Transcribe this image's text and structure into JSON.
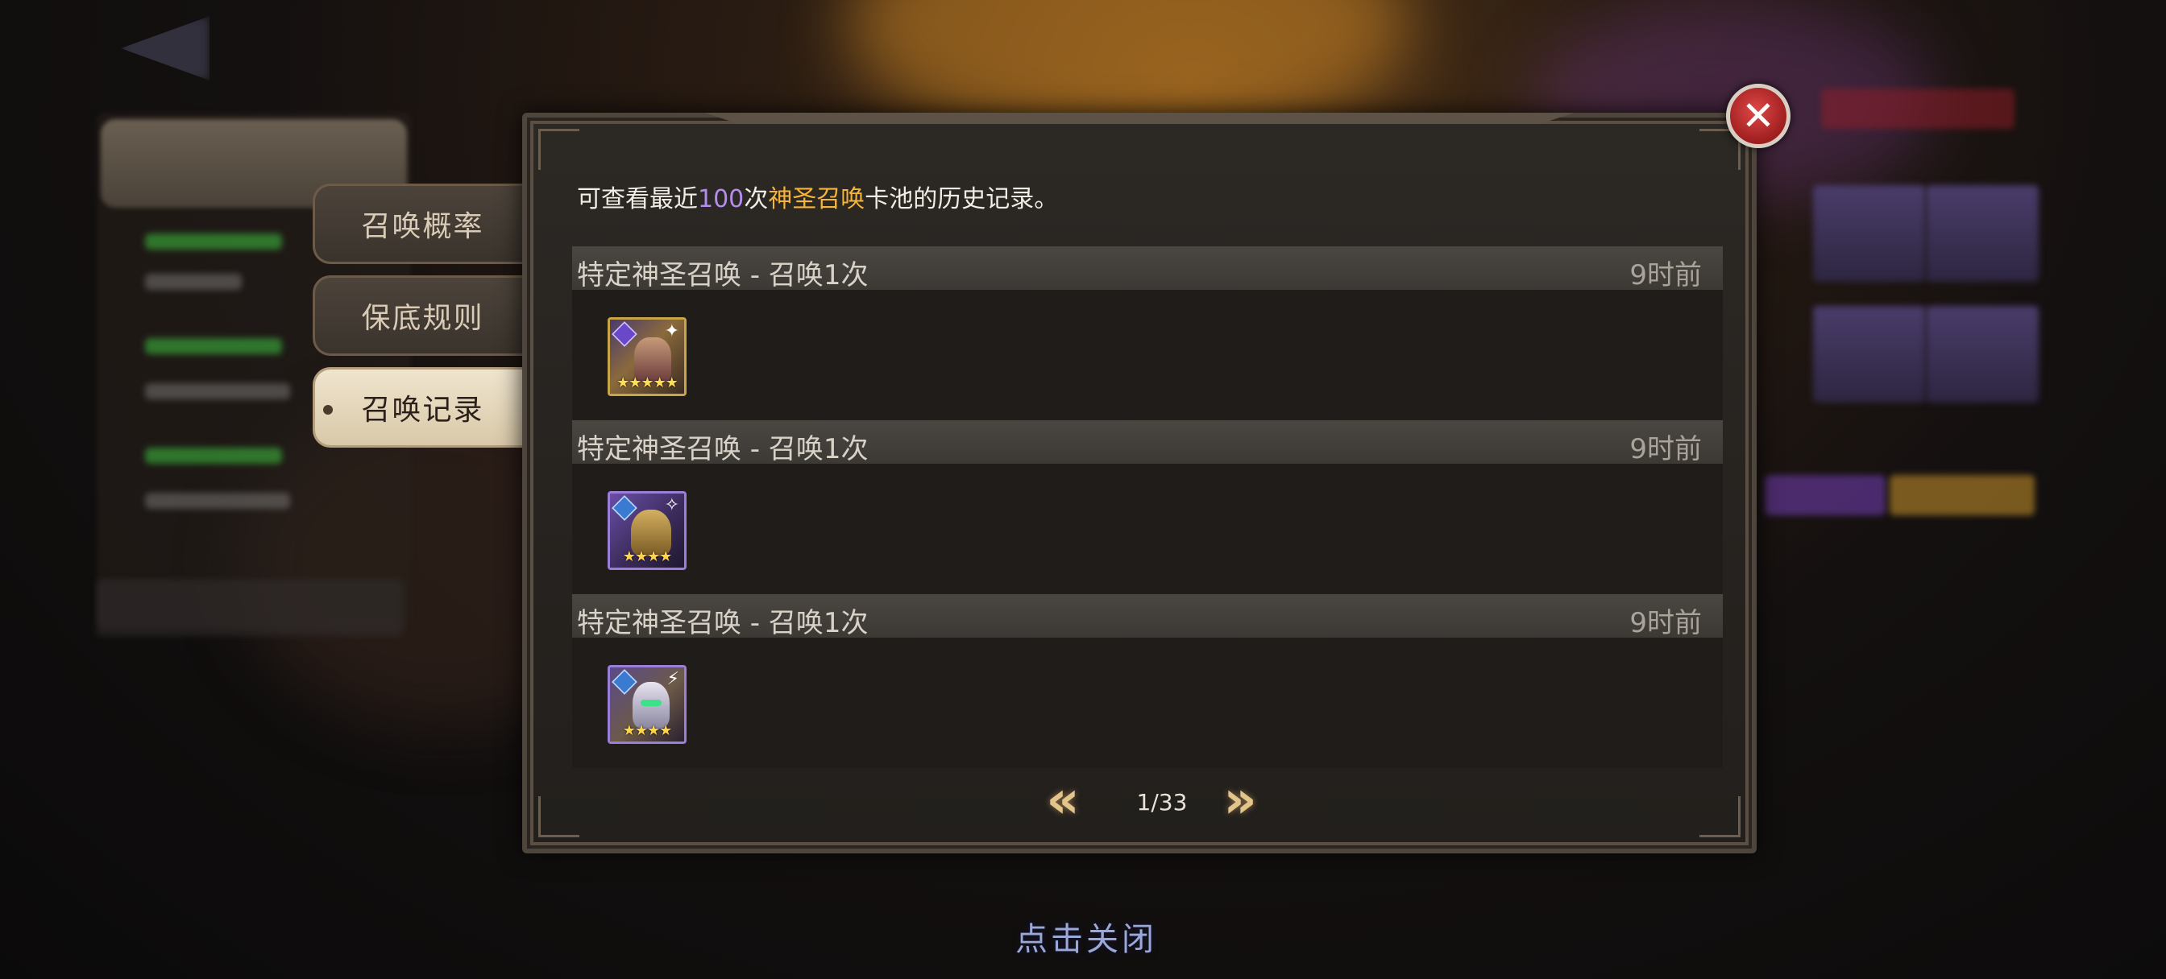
{
  "side_tabs": [
    {
      "label": "召唤概率",
      "active": false
    },
    {
      "label": "保底规则",
      "active": false
    },
    {
      "label": "召唤记录",
      "active": true
    }
  ],
  "dialog": {
    "intro": {
      "prefix": "可查看最近",
      "count": "100",
      "mid": "次",
      "pool_name": "神圣召唤",
      "suffix": "卡池的历史记录。"
    },
    "records": [
      {
        "title": "特定神圣召唤 - 召唤1次",
        "time": "9时前",
        "hero": {
          "stars": "★★★★★",
          "icon": "hero-portrait-icon"
        }
      },
      {
        "title": "特定神圣召唤 - 召唤1次",
        "time": "9时前",
        "hero": {
          "stars": "★★★★",
          "icon": "hero-portrait-icon"
        }
      },
      {
        "title": "特定神圣召唤 - 召唤1次",
        "time": "9时前",
        "hero": {
          "stars": "★★★★",
          "icon": "hero-portrait-icon"
        }
      }
    ],
    "pager": {
      "prev_icon": "double-chevron-left-icon",
      "next_icon": "double-chevron-right-icon",
      "page": "1/33"
    },
    "close_icon": "close-icon"
  },
  "tap_to_close": "点击关闭",
  "colors": {
    "count_highlight": "#b48cf0",
    "pool_highlight": "#f5b43a",
    "close_red": "#c83232"
  }
}
